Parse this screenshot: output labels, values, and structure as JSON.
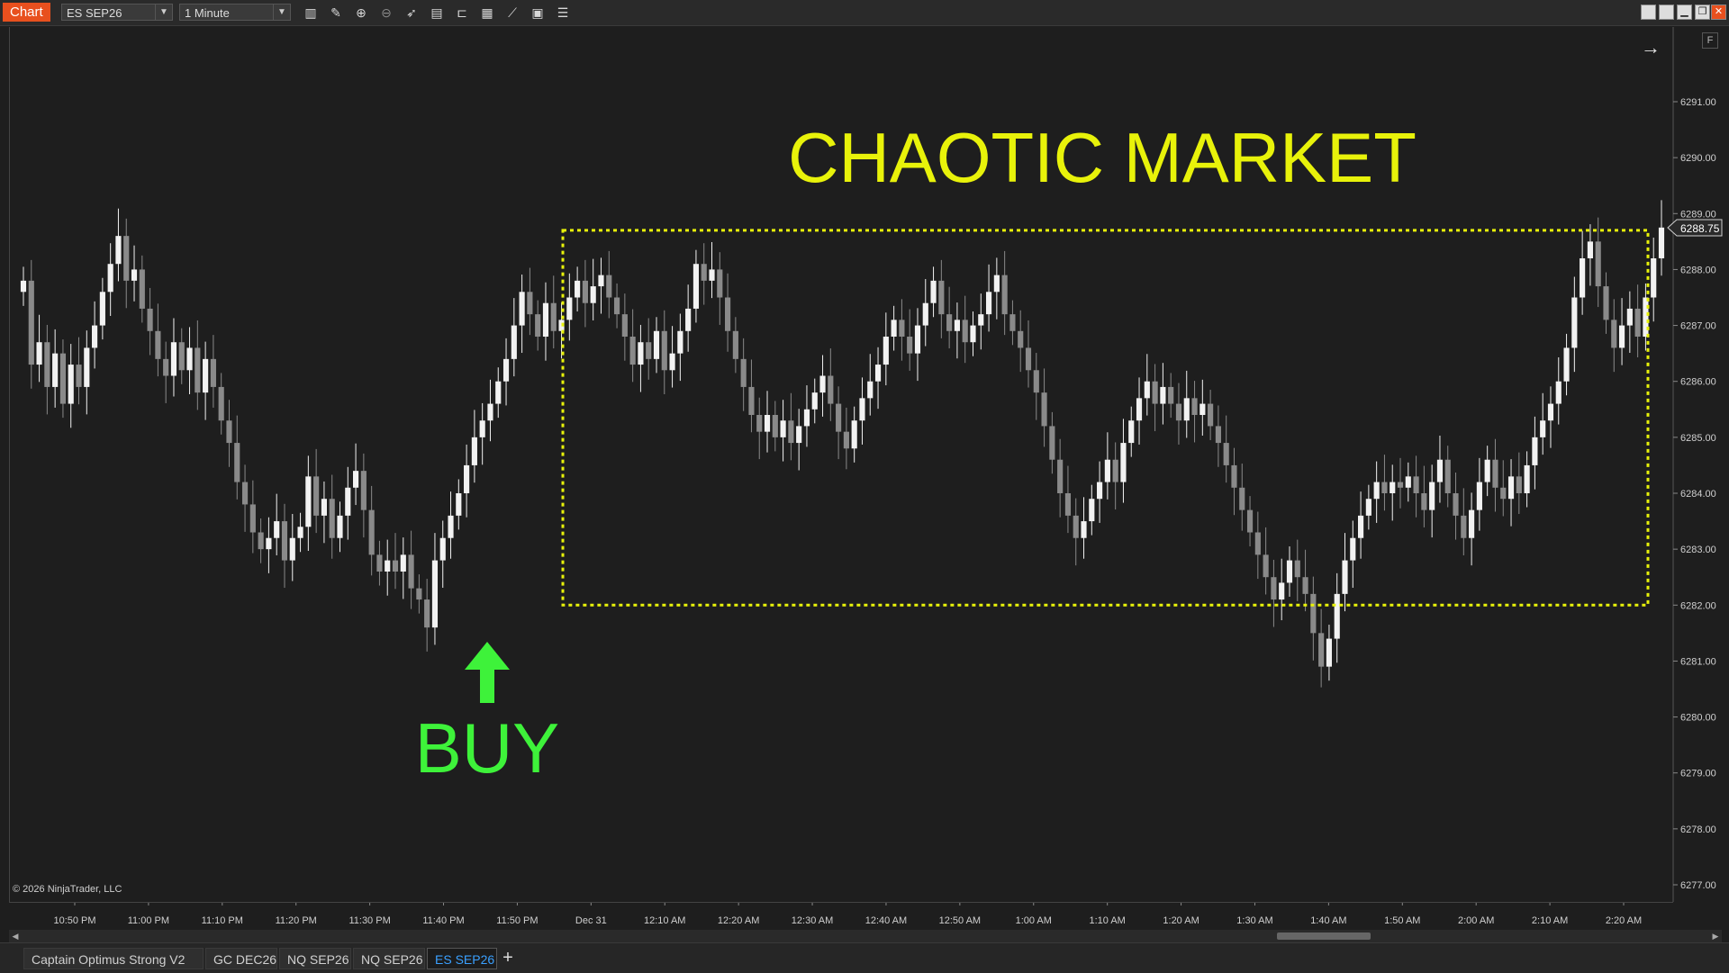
{
  "window": {
    "app_tag": "Chart",
    "instrument": "ES SEP26",
    "interval": "1 Minute"
  },
  "toolbar_icons": [
    "bar-chart-icon",
    "pencil-icon",
    "zoom-in-icon",
    "zoom-out-icon",
    "pointer-icon",
    "data-box-icon",
    "templates-icon",
    "layout-icon",
    "strategy-icon",
    "calculator-icon",
    "properties-icon"
  ],
  "window_buttons": [
    "tile-icon",
    "tile-icon",
    "minimize-icon",
    "restore-icon",
    "close-icon"
  ],
  "chart": {
    "annotation_title": "CHAOTIC MARKET",
    "buy_label": "BUY",
    "annotation_color": "#e8f20a",
    "buy_color": "#3ef23a",
    "current_price_label": "6288.75",
    "copyright": "© 2026 NinjaTrader, LLC",
    "f_button": "F"
  },
  "chart_data": {
    "type": "candlestick",
    "title": "",
    "y_ticks": [
      "6291.00",
      "6290.00",
      "6289.00",
      "6288.00",
      "6287.00",
      "6286.00",
      "6285.00",
      "6284.00",
      "6283.00",
      "6282.00",
      "6281.00",
      "6280.00",
      "6279.00",
      "6278.00",
      "6277.00"
    ],
    "ylim": [
      6276.6,
      6291.8
    ],
    "x_ticks": [
      "10:50 PM",
      "11:00 PM",
      "11:10 PM",
      "11:20 PM",
      "11:30 PM",
      "11:40 PM",
      "11:50 PM",
      "Dec 31",
      "12:10 AM",
      "12:20 AM",
      "12:30 AM",
      "12:40 AM",
      "12:50 AM",
      "1:00 AM",
      "1:10 AM",
      "1:20 AM",
      "1:30 AM",
      "1:40 AM",
      "1:50 AM",
      "2:00 AM",
      "2:10 AM",
      "2:20 AM"
    ],
    "closes": [
      6287.8,
      6286.3,
      6286.7,
      6285.9,
      6286.5,
      6285.6,
      6286.3,
      6285.9,
      6286.6,
      6287.0,
      6287.6,
      6288.1,
      6288.6,
      6287.8,
      6288.0,
      6287.3,
      6286.9,
      6286.4,
      6286.1,
      6286.7,
      6286.2,
      6286.6,
      6285.8,
      6286.4,
      6285.9,
      6285.3,
      6284.9,
      6284.2,
      6283.8,
      6283.3,
      6283.0,
      6283.2,
      6283.5,
      6282.8,
      6283.2,
      6283.4,
      6284.3,
      6283.6,
      6283.9,
      6283.2,
      6283.6,
      6284.1,
      6284.4,
      6283.7,
      6282.9,
      6282.6,
      6282.8,
      6282.6,
      6282.9,
      6282.3,
      6282.1,
      6281.6,
      6282.8,
      6283.2,
      6283.6,
      6284.0,
      6284.5,
      6285.0,
      6285.3,
      6285.6,
      6286.0,
      6286.4,
      6287.0,
      6287.6,
      6287.2,
      6286.8,
      6287.4,
      6286.9,
      6287.1,
      6287.5,
      6287.8,
      6287.4,
      6287.7,
      6287.9,
      6287.5,
      6287.2,
      6286.8,
      6286.3,
      6286.7,
      6286.4,
      6286.9,
      6286.2,
      6286.5,
      6286.9,
      6287.3,
      6288.1,
      6287.8,
      6288.0,
      6287.5,
      6286.9,
      6286.4,
      6285.9,
      6285.4,
      6285.1,
      6285.4,
      6285.0,
      6285.3,
      6284.9,
      6285.2,
      6285.5,
      6285.8,
      6286.1,
      6285.6,
      6285.1,
      6284.8,
      6285.3,
      6285.7,
      6286.0,
      6286.3,
      6286.8,
      6287.1,
      6286.8,
      6286.5,
      6287.0,
      6287.4,
      6287.8,
      6287.2,
      6286.9,
      6287.1,
      6286.7,
      6287.0,
      6287.2,
      6287.6,
      6287.9,
      6287.2,
      6286.9,
      6286.6,
      6286.2,
      6285.8,
      6285.2,
      6284.6,
      6284.0,
      6283.6,
      6283.2,
      6283.5,
      6283.9,
      6284.2,
      6284.6,
      6284.2,
      6284.9,
      6285.3,
      6285.7,
      6286.0,
      6285.6,
      6285.9,
      6285.6,
      6285.3,
      6285.7,
      6285.4,
      6285.6,
      6285.2,
      6284.9,
      6284.5,
      6284.1,
      6283.7,
      6283.3,
      6282.9,
      6282.5,
      6282.1,
      6282.4,
      6282.8,
      6282.5,
      6282.2,
      6281.5,
      6280.9,
      6281.4,
      6282.2,
      6282.8,
      6283.2,
      6283.6,
      6283.9,
      6284.2,
      6284.0,
      6284.2,
      6284.1,
      6284.3,
      6284.0,
      6283.7,
      6284.2,
      6284.6,
      6284.0,
      6283.6,
      6283.2,
      6283.7,
      6284.2,
      6284.6,
      6284.1,
      6283.9,
      6284.3,
      6284.0,
      6284.5,
      6285.0,
      6285.3,
      6285.6,
      6286.0,
      6286.6,
      6287.5,
      6288.2,
      6288.5,
      6287.7,
      6287.1,
      6286.6,
      6287.0,
      6287.3,
      6286.8,
      6287.5,
      6288.2,
      6288.75
    ],
    "annotations": [
      {
        "label": "CHAOTIC MARKET",
        "type": "range-box",
        "y_range": [
          6282.0,
          6288.7
        ]
      },
      {
        "label": "BUY",
        "type": "arrow-up",
        "x_label": "11:45 PM",
        "y": 6281.2
      }
    ]
  },
  "tabs": {
    "items": [
      "Captain Optimus Strong V2",
      "GC DEC26",
      "NQ SEP26",
      "NQ SEP26",
      "ES SEP26"
    ],
    "active_index": 4,
    "add_label": "+"
  }
}
